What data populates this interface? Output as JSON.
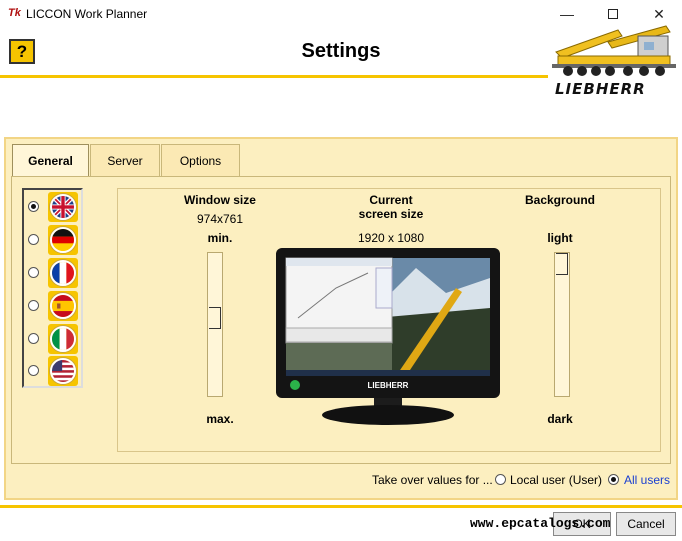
{
  "window": {
    "title": "LICCON Work Planner",
    "icon": "tk-app-icon"
  },
  "header": {
    "help_label": "?",
    "title": "Settings",
    "brand": "LIEBHERR"
  },
  "tabs": [
    {
      "label": "General",
      "active": true
    },
    {
      "label": "Server",
      "active": false
    },
    {
      "label": "Options",
      "active": false
    }
  ],
  "languages": [
    {
      "flag": "uk-flag-icon",
      "selected": true
    },
    {
      "flag": "germany-flag-icon",
      "selected": false
    },
    {
      "flag": "france-flag-icon",
      "selected": false
    },
    {
      "flag": "spain-flag-icon",
      "selected": false
    },
    {
      "flag": "italy-flag-icon",
      "selected": false
    },
    {
      "flag": "usa-flag-icon",
      "selected": false
    }
  ],
  "window_size": {
    "heading": "Window size",
    "value": "974x761",
    "min_label": "min.",
    "max_label": "max.",
    "level": 0.45
  },
  "screen": {
    "heading_line1": "Current",
    "heading_line2": "screen size",
    "value": "1920 x 1080",
    "monitor_brand": "LIEBHERR"
  },
  "background": {
    "heading": "Background",
    "light_label": "light",
    "dark_label": "dark",
    "level": 0.0
  },
  "take_over": {
    "label": "Take over values for ...",
    "options": [
      {
        "label": "Local user (User)",
        "selected": false
      },
      {
        "label": "All users",
        "selected": true
      }
    ]
  },
  "buttons": {
    "ok": "OK",
    "cancel": "Cancel"
  },
  "watermark": "www.epcatalogs.com",
  "colors": {
    "accent": "#f6c400",
    "panel": "#fcefc0",
    "link": "#1a3fd0"
  }
}
